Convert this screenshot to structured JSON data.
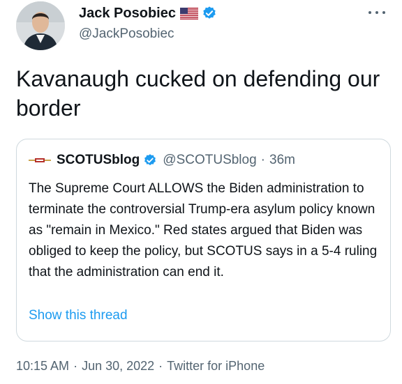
{
  "author": {
    "display_name": "Jack Posobiec",
    "handle": "@JackPosobiec",
    "flag_icon": "us-flag-icon",
    "verified_icon": "verified-badge-icon"
  },
  "tweet": {
    "text": "Kavanaugh cucked on defending our border"
  },
  "quote": {
    "display_name": "SCOTUSblog",
    "handle": "@SCOTUSblog",
    "separator": "·",
    "time": "36m",
    "text": "The Supreme Court ALLOWS the Biden administration to terminate the controversial Trump-era asylum policy known as \"remain in Mexico.\" Red states argued that Biden was obliged to keep the policy, but SCOTUS says in a 5-4 ruling that the administration can end it.",
    "show_thread": "Show this thread"
  },
  "meta": {
    "time": "10:15 AM",
    "date": "Jun 30, 2022",
    "source": "Twitter for iPhone",
    "separator": "·"
  },
  "colors": {
    "accent": "#1d9bf0",
    "secondary_text": "#536471",
    "border": "#cfd9de"
  }
}
